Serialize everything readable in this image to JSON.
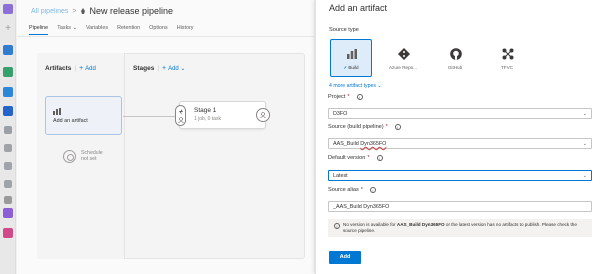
{
  "breadcrumb": {
    "root": "All pipelines",
    "separator": ">",
    "title": "New release pipeline"
  },
  "tabs": [
    {
      "label": "Pipeline",
      "active": true
    },
    {
      "label": "Tasks ⌄",
      "active": false
    },
    {
      "label": "Variables",
      "active": false
    },
    {
      "label": "Retention",
      "active": false
    },
    {
      "label": "Options",
      "active": false
    },
    {
      "label": "History",
      "active": false
    }
  ],
  "artifacts": {
    "title": "Artifacts",
    "separator": "|",
    "add_label": "Add",
    "add_artifact_label": "Add an artifact",
    "schedule_line1": "Schedule",
    "schedule_line2": "not set"
  },
  "stages": {
    "title": "Stages",
    "separator": "|",
    "add_label": "Add ⌄",
    "stage_name": "Stage 1",
    "stage_sub": "1 job, 0 task"
  },
  "panel": {
    "title": "Add an artifact",
    "source_type_label": "Source type",
    "source_types": [
      {
        "label": "Build",
        "icon": "build-icon",
        "selected": true
      },
      {
        "label": "Azure Repo...",
        "icon": "azure-repos-icon",
        "selected": false
      },
      {
        "label": "GitHub",
        "icon": "github-icon",
        "selected": false
      },
      {
        "label": "TFVC",
        "icon": "tfvc-icon",
        "selected": false
      }
    ],
    "more_types": "4 more artifact types ⌄",
    "project_label": "Project",
    "project_value": "D3FO",
    "source_label": "Source (build pipeline)",
    "source_value_prefix": "AAS_Build ",
    "source_value_squiggle": "Dyn365FO",
    "default_version_label": "Default version",
    "default_version_value": "Latest",
    "source_alias_label": "Source alias",
    "source_alias_value": "_AAS_Build Dyn365FO",
    "alert_pre": "No version is available for ",
    "alert_bold": "AAS_Build Dyn365FO",
    "alert_post": " or the latest version has no artifacts to publish. Please check the source pipeline.",
    "required_marker": "*",
    "add_button": "Add"
  },
  "colors": {
    "accent": "#0078d4",
    "required": "#a4262c"
  }
}
